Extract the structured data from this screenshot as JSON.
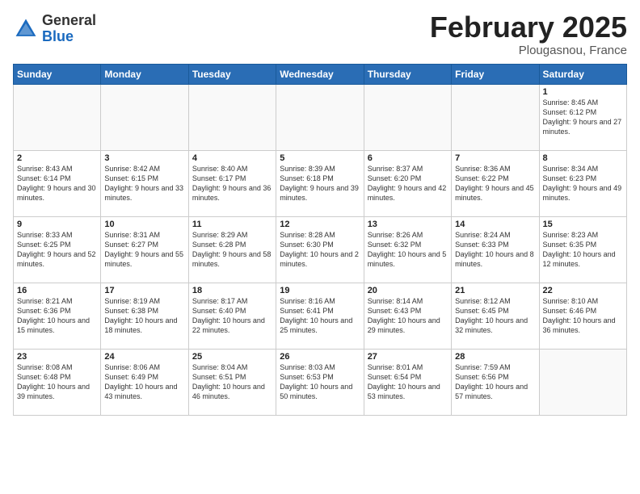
{
  "header": {
    "logo_general": "General",
    "logo_blue": "Blue",
    "month_title": "February 2025",
    "subtitle": "Plougasnou, France"
  },
  "days_of_week": [
    "Sunday",
    "Monday",
    "Tuesday",
    "Wednesday",
    "Thursday",
    "Friday",
    "Saturday"
  ],
  "weeks": [
    [
      {
        "day": "",
        "info": ""
      },
      {
        "day": "",
        "info": ""
      },
      {
        "day": "",
        "info": ""
      },
      {
        "day": "",
        "info": ""
      },
      {
        "day": "",
        "info": ""
      },
      {
        "day": "",
        "info": ""
      },
      {
        "day": "1",
        "info": "Sunrise: 8:45 AM\nSunset: 6:12 PM\nDaylight: 9 hours and 27 minutes."
      }
    ],
    [
      {
        "day": "2",
        "info": "Sunrise: 8:43 AM\nSunset: 6:14 PM\nDaylight: 9 hours and 30 minutes."
      },
      {
        "day": "3",
        "info": "Sunrise: 8:42 AM\nSunset: 6:15 PM\nDaylight: 9 hours and 33 minutes."
      },
      {
        "day": "4",
        "info": "Sunrise: 8:40 AM\nSunset: 6:17 PM\nDaylight: 9 hours and 36 minutes."
      },
      {
        "day": "5",
        "info": "Sunrise: 8:39 AM\nSunset: 6:18 PM\nDaylight: 9 hours and 39 minutes."
      },
      {
        "day": "6",
        "info": "Sunrise: 8:37 AM\nSunset: 6:20 PM\nDaylight: 9 hours and 42 minutes."
      },
      {
        "day": "7",
        "info": "Sunrise: 8:36 AM\nSunset: 6:22 PM\nDaylight: 9 hours and 45 minutes."
      },
      {
        "day": "8",
        "info": "Sunrise: 8:34 AM\nSunset: 6:23 PM\nDaylight: 9 hours and 49 minutes."
      }
    ],
    [
      {
        "day": "9",
        "info": "Sunrise: 8:33 AM\nSunset: 6:25 PM\nDaylight: 9 hours and 52 minutes."
      },
      {
        "day": "10",
        "info": "Sunrise: 8:31 AM\nSunset: 6:27 PM\nDaylight: 9 hours and 55 minutes."
      },
      {
        "day": "11",
        "info": "Sunrise: 8:29 AM\nSunset: 6:28 PM\nDaylight: 9 hours and 58 minutes."
      },
      {
        "day": "12",
        "info": "Sunrise: 8:28 AM\nSunset: 6:30 PM\nDaylight: 10 hours and 2 minutes."
      },
      {
        "day": "13",
        "info": "Sunrise: 8:26 AM\nSunset: 6:32 PM\nDaylight: 10 hours and 5 minutes."
      },
      {
        "day": "14",
        "info": "Sunrise: 8:24 AM\nSunset: 6:33 PM\nDaylight: 10 hours and 8 minutes."
      },
      {
        "day": "15",
        "info": "Sunrise: 8:23 AM\nSunset: 6:35 PM\nDaylight: 10 hours and 12 minutes."
      }
    ],
    [
      {
        "day": "16",
        "info": "Sunrise: 8:21 AM\nSunset: 6:36 PM\nDaylight: 10 hours and 15 minutes."
      },
      {
        "day": "17",
        "info": "Sunrise: 8:19 AM\nSunset: 6:38 PM\nDaylight: 10 hours and 18 minutes."
      },
      {
        "day": "18",
        "info": "Sunrise: 8:17 AM\nSunset: 6:40 PM\nDaylight: 10 hours and 22 minutes."
      },
      {
        "day": "19",
        "info": "Sunrise: 8:16 AM\nSunset: 6:41 PM\nDaylight: 10 hours and 25 minutes."
      },
      {
        "day": "20",
        "info": "Sunrise: 8:14 AM\nSunset: 6:43 PM\nDaylight: 10 hours and 29 minutes."
      },
      {
        "day": "21",
        "info": "Sunrise: 8:12 AM\nSunset: 6:45 PM\nDaylight: 10 hours and 32 minutes."
      },
      {
        "day": "22",
        "info": "Sunrise: 8:10 AM\nSunset: 6:46 PM\nDaylight: 10 hours and 36 minutes."
      }
    ],
    [
      {
        "day": "23",
        "info": "Sunrise: 8:08 AM\nSunset: 6:48 PM\nDaylight: 10 hours and 39 minutes."
      },
      {
        "day": "24",
        "info": "Sunrise: 8:06 AM\nSunset: 6:49 PM\nDaylight: 10 hours and 43 minutes."
      },
      {
        "day": "25",
        "info": "Sunrise: 8:04 AM\nSunset: 6:51 PM\nDaylight: 10 hours and 46 minutes."
      },
      {
        "day": "26",
        "info": "Sunrise: 8:03 AM\nSunset: 6:53 PM\nDaylight: 10 hours and 50 minutes."
      },
      {
        "day": "27",
        "info": "Sunrise: 8:01 AM\nSunset: 6:54 PM\nDaylight: 10 hours and 53 minutes."
      },
      {
        "day": "28",
        "info": "Sunrise: 7:59 AM\nSunset: 6:56 PM\nDaylight: 10 hours and 57 minutes."
      },
      {
        "day": "",
        "info": ""
      }
    ]
  ]
}
